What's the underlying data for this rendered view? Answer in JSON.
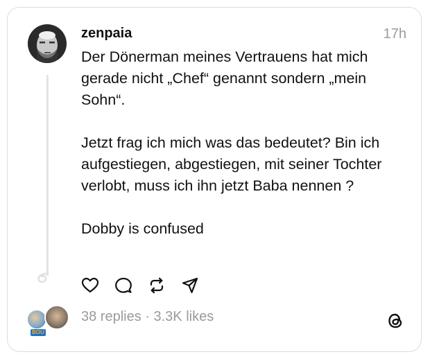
{
  "post": {
    "username": "zenpaia",
    "time": "17h",
    "paragraphs": [
      "Der Dönerman meines Vertrauens hat mich gerade nicht „Chef“ genannt sondern „mein Sohn“.",
      "Jetzt frag ich mich was das bedeutet? Bin ich aufgestiegen, abgestiegen, mit seiner Tochter verlobt, muss ich ihn jetzt Baba nennen ?",
      "Dobby is confused"
    ]
  },
  "actions": {
    "icons": [
      "heart-icon",
      "comment-icon",
      "repost-icon",
      "share-icon"
    ]
  },
  "footer": {
    "replies": "38 replies",
    "separator": " · ",
    "likes": "3.3K likes",
    "mini_avatar_tag": "BOU"
  },
  "colors": {
    "text": "#111111",
    "muted": "#9a9a9a",
    "border": "#dcdcdc"
  }
}
